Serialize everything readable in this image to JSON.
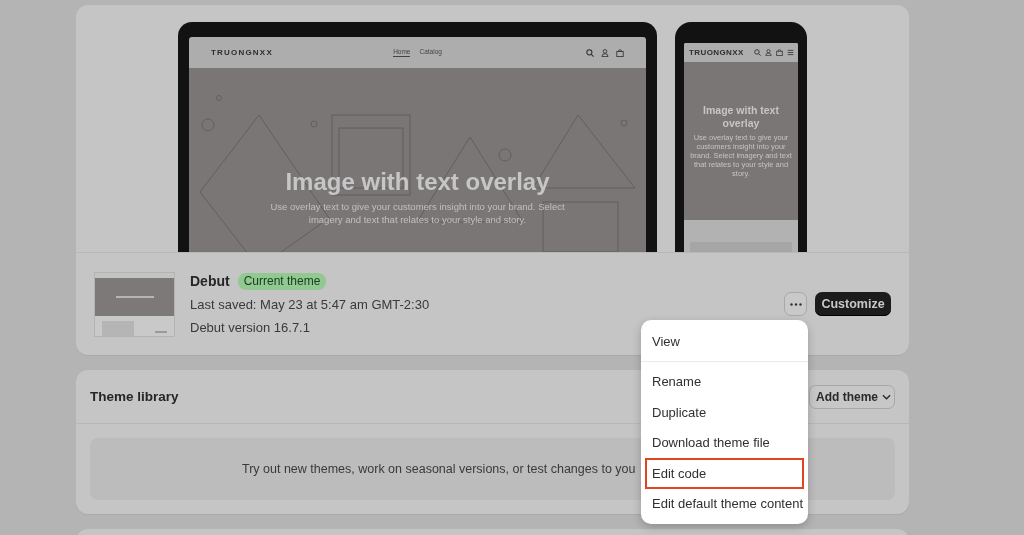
{
  "preview": {
    "desktop": {
      "logo": "TRUONGNXX",
      "nav": [
        {
          "label": "Home",
          "selected": true
        },
        {
          "label": "Catalog",
          "selected": false
        }
      ],
      "hero_title": "Image with text overlay",
      "hero_text": "Use overlay text to give your customers insight into your brand. Select imagery and text that relates to your style and story."
    },
    "mobile": {
      "logo": "TRUONGNXX",
      "hero_title": "Image with text overlay",
      "hero_text": "Use overlay text to give your customers insight into your brand. Select imagery and text that relates to your style and story."
    }
  },
  "current_theme": {
    "name": "Debut",
    "badge": "Current theme",
    "last_saved": "Last saved: May 23 at 5:47 am GMT-2:30",
    "version": "Debut version 16.7.1",
    "button": "Customize"
  },
  "theme_library": {
    "title": "Theme library",
    "button": "Add theme",
    "empty_text": "Try out new themes, work on seasonal versions, or test changes to you"
  },
  "menu": {
    "sections": [
      {
        "items": [
          {
            "label": "View",
            "highlighted": false
          }
        ]
      },
      {
        "items": [
          {
            "label": "Rename",
            "highlighted": false
          },
          {
            "label": "Duplicate",
            "highlighted": false
          },
          {
            "label": "Download theme file",
            "highlighted": false
          },
          {
            "label": "Edit code",
            "highlighted": true
          },
          {
            "label": "Edit default theme content",
            "highlighted": false
          }
        ]
      }
    ]
  }
}
